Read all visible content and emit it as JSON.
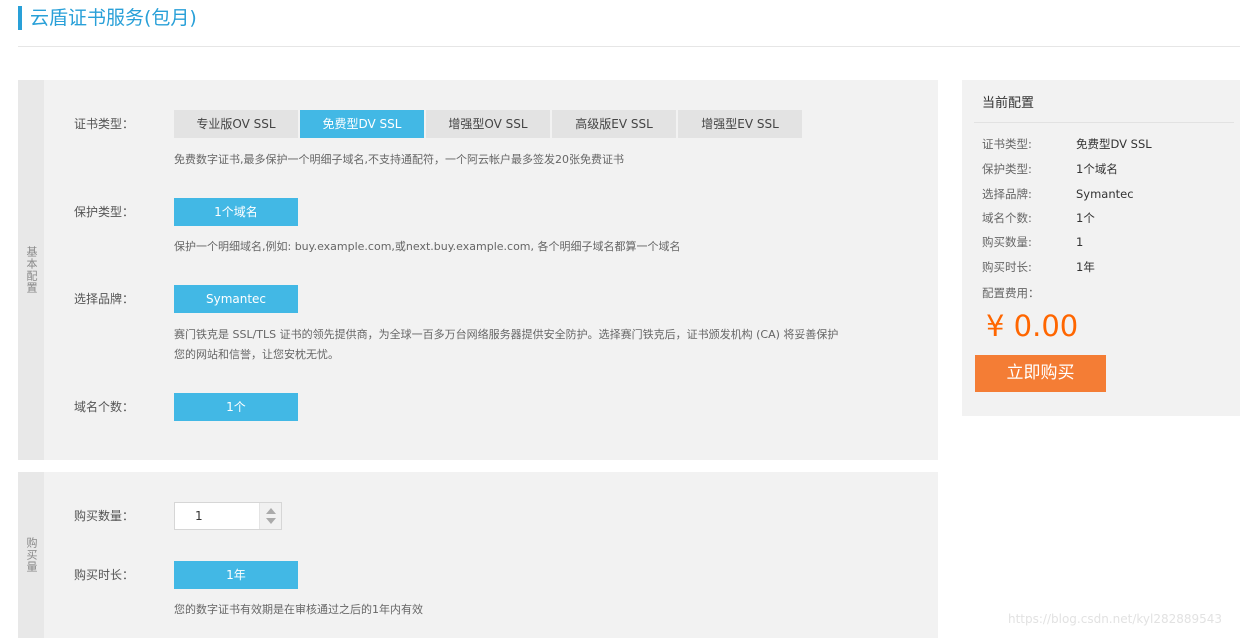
{
  "page": {
    "title": "云盾证书服务(包月)"
  },
  "basic": {
    "section_label": "基本配置",
    "cert_type": {
      "label": "证书类型：",
      "tabs": [
        "专业版OV SSL",
        "免费型DV SSL",
        "增强型OV SSL",
        "高级版EV SSL",
        "增强型EV SSL"
      ],
      "selected": "免费型DV SSL",
      "desc": "免费数字证书,最多保护一个明细子域名,不支持通配符，一个阿云帐户最多签发20张免费证书"
    },
    "protect_type": {
      "label": "保护类型：",
      "value": "1个域名",
      "desc": "保护一个明细域名,例如: buy.example.com,或next.buy.example.com, 各个明细子域名都算一个域名"
    },
    "brand": {
      "label": "选择品牌：",
      "value": "Symantec",
      "desc_line1": "赛门铁克是 SSL/TLS 证书的领先提供商，为全球一百多万台网络服务器提供安全防护。选择赛门铁克后，证书颁发机构 (CA) 将妥善保护",
      "desc_line2": "您的网站和信誉，让您安枕无忧。"
    },
    "domain_count": {
      "label": "域名个数：",
      "value": "1个"
    }
  },
  "purchase": {
    "section_label": "购买量",
    "quantity": {
      "label": "购买数量：",
      "value": "1"
    },
    "duration": {
      "label": "购买时长：",
      "value": "1年",
      "desc": "您的数字证书有效期是在审核通过之后的1年内有效"
    }
  },
  "summary": {
    "title": "当前配置",
    "rows": [
      {
        "k": "证书类型:",
        "v": "免费型DV SSL"
      },
      {
        "k": "保护类型:",
        "v": "1个域名"
      },
      {
        "k": "选择品牌:",
        "v": "Symantec"
      },
      {
        "k": "域名个数:",
        "v": "1个"
      },
      {
        "k": "购买数量:",
        "v": "1"
      },
      {
        "k": "购买时长:",
        "v": "1年"
      }
    ],
    "price_label": "配置费用：",
    "price": "¥ 0.00",
    "buy_label": "立即购买"
  },
  "watermark": "https://blog.csdn.net/kyl282889543",
  "colors": {
    "accent": "#42b8e5",
    "title": "#29a0d8",
    "price": "#ff6600",
    "buy_button": "#f47d35"
  }
}
